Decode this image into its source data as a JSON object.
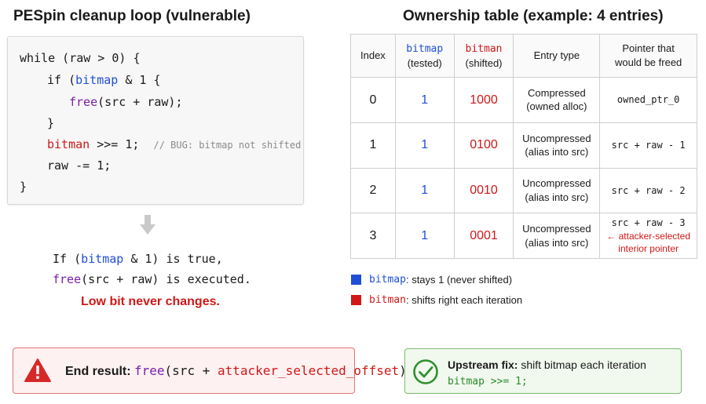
{
  "left_title": "PESpin cleanup loop (vulnerable)",
  "right_title": "Ownership table (example: 4 entries)",
  "code": {
    "l1": "while (raw > 0) {",
    "l2_if": "if (",
    "l2_var": "bitmap",
    "l2_rest": " & 1 {",
    "l3_fn": "free",
    "l3_rest": "(src + raw);",
    "l4": "}",
    "l5_var": "bitman",
    "l5_rest": " >>= 1;",
    "l5_comment": "// BUG: bitmap not shifted",
    "l6": "raw -= 1;",
    "l7": "}"
  },
  "explain": {
    "line1_a": "If (",
    "line1_var": "bitmap",
    "line1_b": " & 1) is true,",
    "line2_fn": "free",
    "line2_b": "(src + raw) is executed.",
    "line3": "Low bit never changes."
  },
  "table": {
    "headers": {
      "index": "Index",
      "bitmap": "bitmap",
      "bitmap_sub": "(tested)",
      "bitman": "bitman",
      "bitman_sub": "(shifted)",
      "entry_type": "Entry type",
      "pointer_1": "Pointer that",
      "pointer_2": "would be freed"
    },
    "rows": [
      {
        "index": "0",
        "bitmap": "1",
        "bitman": "1000",
        "type1": "Compressed",
        "type2": "(owned alloc)",
        "ptr": "owned_ptr_0",
        "note1": "",
        "note2": ""
      },
      {
        "index": "1",
        "bitmap": "1",
        "bitman": "0100",
        "type1": "Uncompressed",
        "type2": "(alias into src)",
        "ptr": "src + raw - 1",
        "note1": "",
        "note2": ""
      },
      {
        "index": "2",
        "bitmap": "1",
        "bitman": "0010",
        "type1": "Uncompressed",
        "type2": "(alias into src)",
        "ptr": "src + raw - 2",
        "note1": "",
        "note2": ""
      },
      {
        "index": "3",
        "bitmap": "1",
        "bitman": "0001",
        "type1": "Uncompressed",
        "type2": "(alias into src)",
        "ptr": "src + raw - 3",
        "note1": "← attacker-selected",
        "note2": "interior pointer"
      }
    ]
  },
  "legend": {
    "blue_var": "bitmap",
    "blue_text": ": stays 1 (never shifted)",
    "red_var": "bitman",
    "red_text": ": shifts right each iteration",
    "blue_color": "#1f4fd6",
    "red_color": "#d01818"
  },
  "result": {
    "label": "End result:",
    "fn": "free",
    "mid": "(src + ",
    "arg": "attacker_selected_offset",
    "end": ")",
    "icon": "warning-icon"
  },
  "fix": {
    "label": "Upstream fix:",
    "text": " shift bitmap each iteration",
    "code": "bitmap >>= 1;",
    "icon": "check-circle-icon"
  }
}
